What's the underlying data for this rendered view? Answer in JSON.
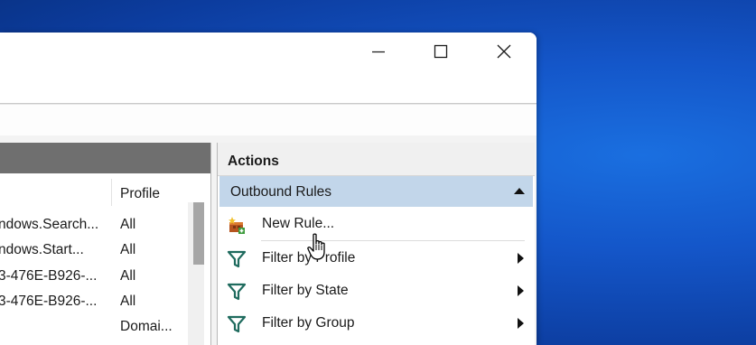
{
  "window": {
    "caption_buttons": [
      "minimize",
      "maximize",
      "close"
    ]
  },
  "rules_list": {
    "columns": {
      "profile": "Profile"
    },
    "rows": [
      {
        "name": "ndows.Search...",
        "profile": "All"
      },
      {
        "name": "ndows.Start...",
        "profile": "All"
      },
      {
        "name": "3-476E-B926-...",
        "profile": "All"
      },
      {
        "name": "3-476E-B926-...",
        "profile": "All"
      },
      {
        "name": "",
        "profile": "Domai..."
      }
    ]
  },
  "actions": {
    "title": "Actions",
    "section": "Outbound Rules",
    "items": [
      {
        "label": "New Rule...",
        "icon": "new-rule-icon"
      },
      {
        "label": "Filter by Profile",
        "icon": "filter-icon"
      },
      {
        "label": "Filter by State",
        "icon": "filter-icon"
      },
      {
        "label": "Filter by Group",
        "icon": "filter-icon"
      }
    ]
  },
  "colors": {
    "desktop": "#1456c9",
    "section_header": "#c2d6ea",
    "left_header": "#6f6f6f",
    "filter_icon": "#1f6b5e"
  }
}
